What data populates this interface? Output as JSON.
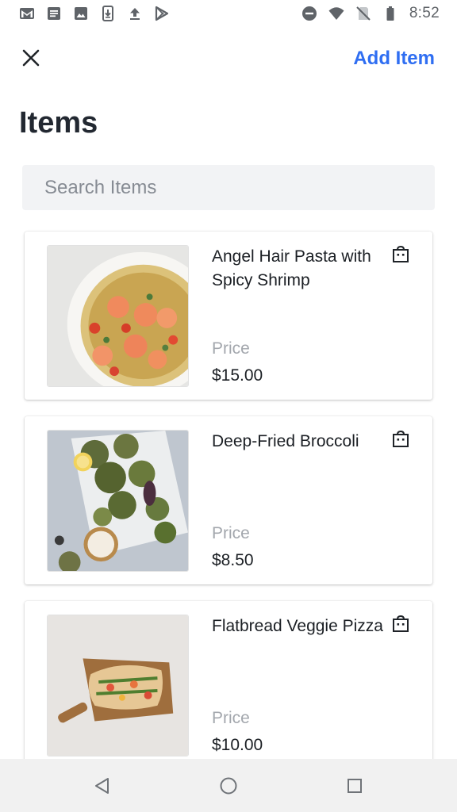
{
  "status_bar": {
    "left_icons": [
      "gmail-icon",
      "document-icon",
      "image-icon",
      "download-icon",
      "upload-icon",
      "play-store-icon"
    ],
    "right_icons": [
      "do-not-disturb-icon",
      "wifi-icon",
      "no-sim-icon",
      "battery-icon"
    ],
    "time": "8:52"
  },
  "header": {
    "close_icon": "close-icon",
    "add_item_label": "Add Item"
  },
  "page": {
    "title": "Items"
  },
  "search": {
    "placeholder": "Search Items",
    "value": ""
  },
  "items": [
    {
      "name": "Angel Hair Pasta with Spicy Shrimp",
      "price_label": "Price",
      "price": "$15.00",
      "image": "pasta-shrimp-photo",
      "icon": "shopping-bag-icon"
    },
    {
      "name": "Deep-Fried Broccoli",
      "price_label": "Price",
      "price": "$8.50",
      "image": "fried-broccoli-photo",
      "icon": "shopping-bag-icon"
    },
    {
      "name": "Flatbread Veggie Pizza",
      "price_label": "Price",
      "price": "$10.00",
      "image": "flatbread-pizza-photo",
      "icon": "shopping-bag-icon"
    }
  ],
  "nav_bar": {
    "buttons": [
      "back-icon",
      "home-icon",
      "recents-icon"
    ]
  },
  "colors": {
    "accent": "#2f6ef2",
    "title": "#222831",
    "muted": "#a3a7ad",
    "search_bg": "#f2f3f5",
    "nav_bg": "#f1f1f1"
  }
}
